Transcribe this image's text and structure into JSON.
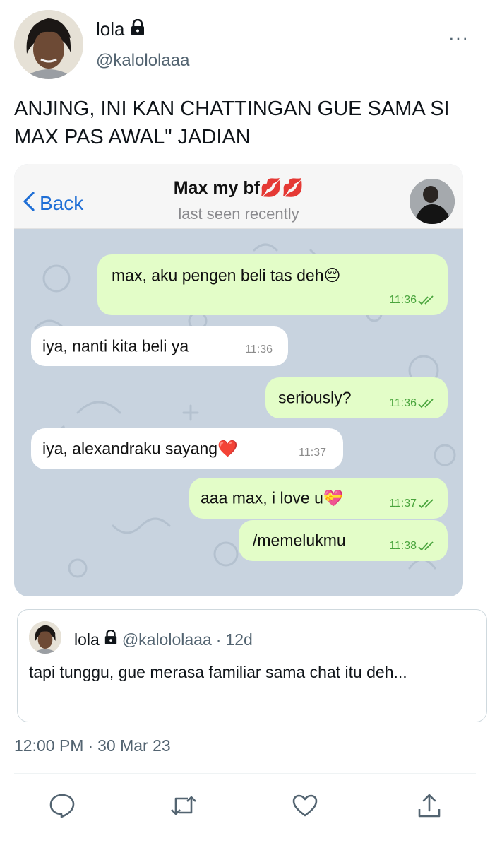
{
  "author": {
    "display_name": "lola",
    "handle": "@kalololaaa",
    "avatar": "author-avatar",
    "verified_lock": "lock-icon"
  },
  "tweet": {
    "text": "ANJING, INI KAN CHATTINGAN GUE SAMA SI MAX PAS AWAL\" JADIAN",
    "more_icon": "more-icon",
    "more_label": "···"
  },
  "chat_screenshot": {
    "back_label": "Back",
    "title": "Max my bf💋💋",
    "status": "last seen recently",
    "messages": [
      {
        "direction": "out",
        "text": "max, aku pengen beli tas deh😔",
        "time": "11:36",
        "read": true
      },
      {
        "direction": "in",
        "text": "iya, nanti kita beli ya",
        "time": "11:36"
      },
      {
        "direction": "out",
        "text": "seriously?",
        "time": "11:36",
        "read": true
      },
      {
        "direction": "in",
        "text": "iya, alexandraku sayang❤️",
        "time": "11:37"
      },
      {
        "direction": "out",
        "text": "aaa max, i love u💝",
        "time": "11:37",
        "read": true
      },
      {
        "direction": "out",
        "text": "/memelukmu",
        "time": "11:38",
        "read": true
      }
    ]
  },
  "quoted_tweet": {
    "display_name": "lola",
    "handle": "@kalololaaa",
    "separator": "·",
    "age": "12d",
    "text": "tapi tunggu, gue merasa familiar sama chat itu deh..."
  },
  "meta": {
    "time": "12:00 PM",
    "separator": "·",
    "date": "30 Mar 23"
  },
  "actions": [
    "reply-icon",
    "retweet-icon",
    "like-icon",
    "share-icon"
  ],
  "colors": {
    "link_blue": "#1f6fd6",
    "outgoing_bubble": "#e3fdc8",
    "incoming_bubble": "#ffffff",
    "chat_background": "#c8d3df",
    "secondary_text": "#536471",
    "read_time_green": "#49a43c"
  }
}
